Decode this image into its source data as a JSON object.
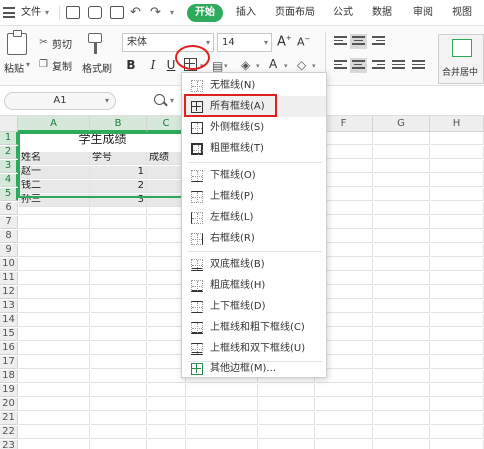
{
  "menubar": {
    "file_label": "文件",
    "tabs": [
      {
        "label": "开始",
        "active": true
      },
      {
        "label": "插入"
      },
      {
        "label": "页面布局"
      },
      {
        "label": "公式"
      },
      {
        "label": "数据"
      },
      {
        "label": "审阅"
      },
      {
        "label": "视图"
      }
    ]
  },
  "ribbon": {
    "paste_label": "粘贴",
    "cut_label": "剪切",
    "copy_label": "复制",
    "format_painter_label": "格式刷",
    "font_name": "宋体",
    "font_size": "14",
    "merge_center_label": "合并居中",
    "accent_color": "#2eaa5c",
    "highlight_color": "#e02020"
  },
  "formula_bar": {
    "cell_ref": "A1"
  },
  "grid": {
    "columns": [
      "A",
      "B",
      "C",
      "D",
      "E",
      "F",
      "G",
      "H"
    ],
    "rows": [
      "1",
      "2",
      "3",
      "4",
      "5",
      "6",
      "7",
      "8",
      "9",
      "10",
      "11",
      "12",
      "13",
      "14",
      "15",
      "16",
      "17",
      "18",
      "19",
      "20",
      "21",
      "22",
      "23"
    ],
    "title": "学生成绩",
    "headers": [
      "姓名",
      "学号",
      "成绩"
    ],
    "data": [
      {
        "name": "赵一",
        "id": "1"
      },
      {
        "name": "钱二",
        "id": "2"
      },
      {
        "name": "孙三",
        "id": "3"
      }
    ]
  },
  "border_menu": {
    "items": [
      {
        "label": "无框线(N)",
        "icon": "no-border-icon"
      },
      {
        "label": "所有框线(A)",
        "icon": "all-borders-icon",
        "highlighted": true
      },
      {
        "label": "外侧框线(S)",
        "icon": "outside-borders-icon"
      },
      {
        "label": "粗匣框线(T)",
        "icon": "thick-box-border-icon"
      },
      {
        "label": "下框线(O)",
        "icon": "bottom-border-icon"
      },
      {
        "label": "上框线(P)",
        "icon": "top-border-icon"
      },
      {
        "label": "左框线(L)",
        "icon": "left-border-icon"
      },
      {
        "label": "右框线(R)",
        "icon": "right-border-icon"
      },
      {
        "label": "双底框线(B)",
        "icon": "double-bottom-border-icon"
      },
      {
        "label": "粗底框线(H)",
        "icon": "thick-bottom-border-icon"
      },
      {
        "label": "上下框线(D)",
        "icon": "top-bottom-border-icon"
      },
      {
        "label": "上框线和粗下框线(C)",
        "icon": "top-thick-bottom-border-icon"
      },
      {
        "label": "上框线和双下框线(U)",
        "icon": "top-double-bottom-border-icon"
      },
      {
        "label": "其他边框(M)...",
        "icon": "more-borders-icon"
      }
    ]
  }
}
